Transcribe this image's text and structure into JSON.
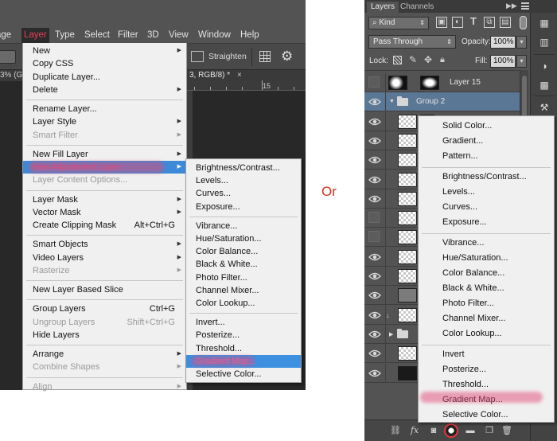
{
  "left": {
    "menubar": {
      "items": [
        "age",
        "Layer",
        "Type",
        "Select",
        "Filter",
        "3D",
        "View",
        "Window",
        "Help"
      ]
    },
    "options": {
      "straighten": "Straighten"
    },
    "tabs": {
      "left_fragment": "3% (G",
      "doc_fragment": "3, RGB/8) *",
      "close": "×"
    },
    "ruler": {
      "mark": "15"
    },
    "layer_menu": [
      {
        "label": "New",
        "submenu": true
      },
      {
        "label": "Copy CSS"
      },
      {
        "label": "Duplicate Layer..."
      },
      {
        "label": "Delete",
        "submenu": true
      },
      {
        "divider": true
      },
      {
        "label": "Rename Layer..."
      },
      {
        "label": "Layer Style",
        "submenu": true
      },
      {
        "label": "Smart Filter",
        "submenu": true,
        "disabled": true
      },
      {
        "divider": true
      },
      {
        "label": "New Fill Layer",
        "submenu": true
      },
      {
        "label": "New Adjustment Layer",
        "submenu": true,
        "highlighted": true
      },
      {
        "label": "Layer Content Options...",
        "disabled": true
      },
      {
        "divider": true
      },
      {
        "label": "Layer Mask",
        "submenu": true
      },
      {
        "label": "Vector Mask",
        "submenu": true
      },
      {
        "label": "Create Clipping Mask",
        "shortcut": "Alt+Ctrl+G"
      },
      {
        "divider": true
      },
      {
        "label": "Smart Objects",
        "submenu": true
      },
      {
        "label": "Video Layers",
        "submenu": true
      },
      {
        "label": "Rasterize",
        "submenu": true,
        "disabled": true
      },
      {
        "divider": true
      },
      {
        "label": "New Layer Based Slice"
      },
      {
        "divider": true
      },
      {
        "label": "Group Layers",
        "shortcut": "Ctrl+G"
      },
      {
        "label": "Ungroup Layers",
        "shortcut": "Shift+Ctrl+G",
        "disabled": true
      },
      {
        "label": "Hide Layers"
      },
      {
        "divider": true
      },
      {
        "label": "Arrange",
        "submenu": true
      },
      {
        "label": "Combine Shapes",
        "submenu": true,
        "disabled": true
      },
      {
        "divider": true
      },
      {
        "label": "Align",
        "submenu": true,
        "disabled": true
      }
    ],
    "adjustment_menu": [
      {
        "label": "Brightness/Contrast..."
      },
      {
        "label": "Levels..."
      },
      {
        "label": "Curves..."
      },
      {
        "label": "Exposure..."
      },
      {
        "divider": true
      },
      {
        "label": "Vibrance..."
      },
      {
        "label": "Hue/Saturation..."
      },
      {
        "label": "Color Balance..."
      },
      {
        "label": "Black & White..."
      },
      {
        "label": "Photo Filter..."
      },
      {
        "label": "Channel Mixer..."
      },
      {
        "label": "Color Lookup..."
      },
      {
        "divider": true
      },
      {
        "label": "Invert..."
      },
      {
        "label": "Posterize..."
      },
      {
        "label": "Threshold..."
      },
      {
        "label": "Gradient Map...",
        "highlighted": true
      },
      {
        "label": "Selective Color..."
      }
    ]
  },
  "or_text": "Or",
  "right": {
    "tabs": [
      "Layers",
      "Channels"
    ],
    "filter": {
      "kind": "Kind"
    },
    "blend_mode": "Pass Through",
    "opacity_label": "Opacity:",
    "opacity_value": "100%",
    "lock_label": "Lock:",
    "fill_label": "Fill:",
    "fill_value": "100%",
    "layers": [
      {
        "name": "Layer 15",
        "visible": false,
        "thumb": "spot"
      },
      {
        "name": "Group 2",
        "visible": true,
        "group": true
      },
      {
        "name": "",
        "visible": true
      },
      {
        "name": "",
        "visible": true
      },
      {
        "name": "",
        "visible": true
      },
      {
        "name": "",
        "visible": true
      },
      {
        "name": "",
        "visible": true
      },
      {
        "name": "",
        "visible": false
      },
      {
        "name": "",
        "visible": false
      },
      {
        "name": "",
        "visible": true
      },
      {
        "name": "",
        "visible": true
      },
      {
        "name": "",
        "visible": true,
        "thumb": "grey"
      },
      {
        "name": "",
        "visible": true,
        "link": true
      },
      {
        "name": "",
        "visible": true,
        "folder": true
      },
      {
        "name": "",
        "visible": true
      },
      {
        "name": "",
        "visible": true,
        "thumb": "dark"
      }
    ],
    "fill_menu": [
      {
        "label": "Solid Color..."
      },
      {
        "label": "Gradient..."
      },
      {
        "label": "Pattern..."
      },
      {
        "divider": true
      },
      {
        "label": "Brightness/Contrast..."
      },
      {
        "label": "Levels..."
      },
      {
        "label": "Curves..."
      },
      {
        "label": "Exposure..."
      },
      {
        "divider": true
      },
      {
        "label": "Vibrance..."
      },
      {
        "label": "Hue/Saturation..."
      },
      {
        "label": "Color Balance..."
      },
      {
        "label": "Black & White..."
      },
      {
        "label": "Photo Filter..."
      },
      {
        "label": "Channel Mixer..."
      },
      {
        "label": "Color Lookup..."
      },
      {
        "divider": true
      },
      {
        "label": "Invert"
      },
      {
        "label": "Posterize..."
      },
      {
        "label": "Threshold..."
      },
      {
        "label": "Gradient Map...",
        "marked": true
      },
      {
        "label": "Selective Color..."
      }
    ]
  }
}
